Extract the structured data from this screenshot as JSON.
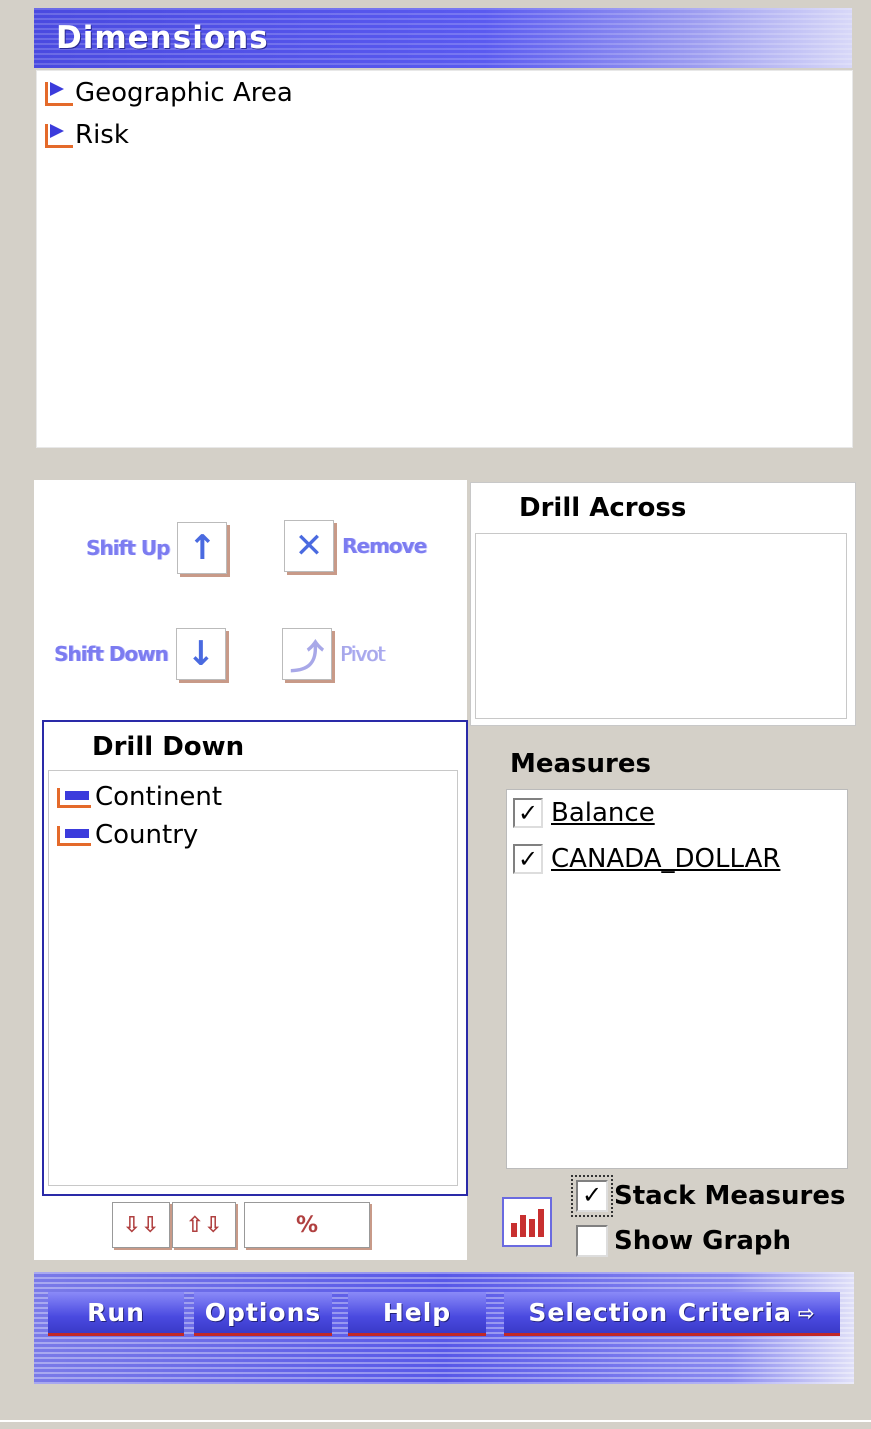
{
  "dimensions": {
    "title": "Dimensions",
    "items": [
      {
        "label": "Geographic Area"
      },
      {
        "label": "Risk"
      }
    ]
  },
  "tools": {
    "shift_up": "Shift Up",
    "remove": "Remove",
    "shift_down": "Shift Down",
    "pivot": "Pivot"
  },
  "drill_across": {
    "title": "Drill Across"
  },
  "drill_down": {
    "title": "Drill Down",
    "items": [
      {
        "label": "Continent"
      },
      {
        "label": "Country"
      }
    ]
  },
  "measures": {
    "title": "Measures",
    "items": [
      {
        "label": "Balance",
        "checked": true
      },
      {
        "label": "CANADA_DOLLAR",
        "checked": true
      }
    ]
  },
  "options": {
    "stack_measures": {
      "label": "Stack Measures",
      "checked": true
    },
    "show_graph": {
      "label": "Show Graph",
      "checked": false
    }
  },
  "buttons": {
    "run": "Run",
    "options": "Options",
    "help": "Help",
    "selection_criteria": "Selection Criteria"
  },
  "colors": {
    "accent": "#4a4ae0",
    "panel_bg": "#d4d0c8",
    "tree_icon_orange": "#e46a2a"
  }
}
